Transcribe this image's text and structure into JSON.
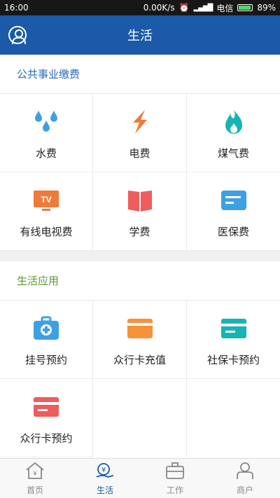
{
  "status_bar": {
    "time": "16:00",
    "speed": "0.00K/s",
    "carrier": "电信",
    "battery": "89%"
  },
  "header": {
    "title": "生活"
  },
  "public_utilities": {
    "title": "公共事业缴费",
    "items": [
      {
        "label": "水费",
        "icon": "water-drops-icon",
        "color": "#3ea0e4"
      },
      {
        "label": "电费",
        "icon": "lightning-icon",
        "color": "#f07a3a"
      },
      {
        "label": "煤气费",
        "icon": "flame-icon",
        "color": "#16b4b4"
      },
      {
        "label": "有线电视费",
        "icon": "tv-icon",
        "color": "#f07a3a"
      },
      {
        "label": "学费",
        "icon": "book-icon",
        "color": "#ef5c5c"
      },
      {
        "label": "医保费",
        "icon": "card-icon",
        "color": "#3ea0e4"
      }
    ]
  },
  "life_apps": {
    "title": "生活应用",
    "items": [
      {
        "label": "挂号预约",
        "icon": "medical-kit-icon",
        "color": "#3ea0e4"
      },
      {
        "label": "众行卡充值",
        "icon": "card-icon",
        "color": "#f7923a"
      },
      {
        "label": "社保卡预约",
        "icon": "card-icon",
        "color": "#16b4b4"
      },
      {
        "label": "众行卡预约",
        "icon": "card-icon",
        "color": "#ef5c5c"
      }
    ]
  },
  "tabbar": {
    "tabs": [
      {
        "label": "首页",
        "icon": "home-icon"
      },
      {
        "label": "生活",
        "icon": "life-yen-icon",
        "active": true
      },
      {
        "label": "工作",
        "icon": "briefcase-icon"
      },
      {
        "label": "商户",
        "icon": "person-icon"
      }
    ]
  }
}
